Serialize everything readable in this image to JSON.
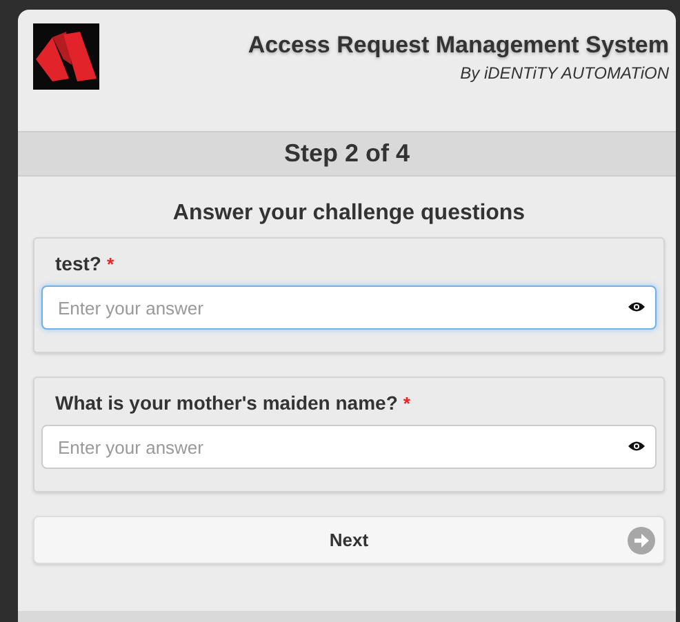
{
  "header": {
    "title": "Access Request Management System",
    "subtitle": "By iDENTiTY AUTOMATiON"
  },
  "step": "Step 2 of 4",
  "heading": "Answer your challenge questions",
  "questions": [
    {
      "label": "test?",
      "required_mark": "*",
      "placeholder": "Enter your answer",
      "focused": true
    },
    {
      "label": "What is your mother's maiden name?",
      "required_mark": "*",
      "placeholder": "Enter your answer",
      "focused": false
    }
  ],
  "next_button": "Next"
}
